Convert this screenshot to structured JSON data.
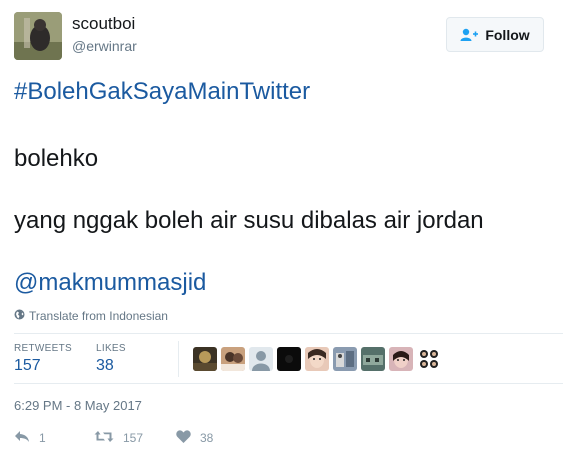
{
  "user": {
    "display_name": "scoutboi",
    "handle": "@erwinrar"
  },
  "follow_button": {
    "label": "Follow",
    "icon": "add-user-icon"
  },
  "tweet": {
    "hashtag": "#BolehGakSayaMainTwitter",
    "line1": "bolehko",
    "line2": "yang nggak boleh air susu dibalas air jordan",
    "mention": "@makmummasjid"
  },
  "translate": {
    "label": "Translate from Indonesian",
    "icon": "globe-icon"
  },
  "stats": {
    "retweets_label": "RETWEETS",
    "retweets_value": "157",
    "likes_label": "LIKES",
    "likes_value": "38"
  },
  "likers_count_shown": 9,
  "timestamp": "6:29 PM - 8 May 2017",
  "actions": {
    "reply_count": "1",
    "retweet_count": "157",
    "like_count": "38"
  },
  "colors": {
    "link": "#1b5aa0",
    "muted": "#657786",
    "icon_muted": "#8899a6",
    "text": "#14171a"
  }
}
